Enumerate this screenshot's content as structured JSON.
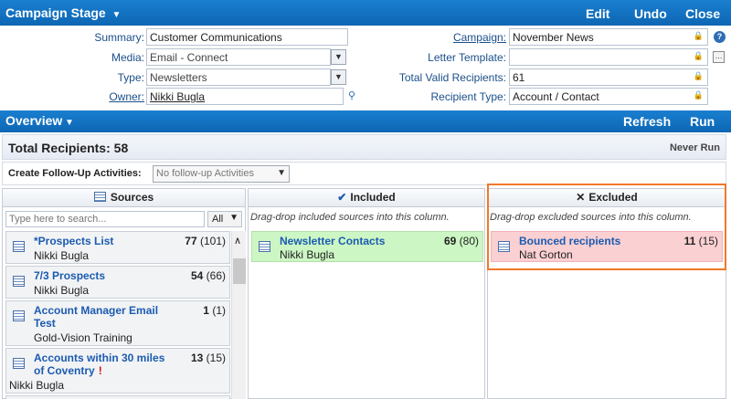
{
  "header": {
    "title": "Campaign Stage",
    "edit": "Edit",
    "undo": "Undo",
    "close": "Close"
  },
  "form": {
    "summary_label": "Summary:",
    "summary_value": "Customer Communications",
    "media_label": "Media:",
    "media_value": "Email - Connect",
    "type_label": "Type:",
    "type_value": "Newsletters",
    "owner_label": "Owner:",
    "owner_value": "Nikki Bugla",
    "campaign_label": "Campaign:",
    "campaign_value": "November News",
    "letter_label": "Letter Template:",
    "letter_value": "",
    "recipients_label": "Total Valid Recipients:",
    "recipients_value": "61",
    "rtype_label": "Recipient Type:",
    "rtype_value": "Account / Contact"
  },
  "overview": {
    "title": "Overview",
    "refresh": "Refresh",
    "run": "Run"
  },
  "totals": {
    "label": "Total Recipients:",
    "value": "58",
    "status": "Never Run"
  },
  "followup": {
    "label": "Create Follow-Up Activities:",
    "value": "No follow-up Activities"
  },
  "sources": {
    "title": "Sources",
    "search_placeholder": "Type here to search...",
    "filter": "All",
    "items": [
      {
        "name": "*Prospects List",
        "count": "77",
        "total": "(101)",
        "owner": "Nikki Bugla"
      },
      {
        "name": "7/3 Prospects",
        "count": "54",
        "total": "(66)",
        "owner": "Nikki Bugla"
      },
      {
        "name": "Account Manager Email Test",
        "count": "1",
        "total": "(1)",
        "owner": "Gold-Vision Training"
      },
      {
        "name": "Accounts within 30 miles of Coventry",
        "count": "13",
        "total": "(15)",
        "owner": "Nikki Bugla"
      }
    ]
  },
  "included": {
    "title": "Included",
    "hint": "Drag-drop included sources into this column.",
    "items": [
      {
        "name": "Newsletter Contacts",
        "count": "69",
        "total": "(80)",
        "owner": "Nikki Bugla"
      }
    ]
  },
  "excluded": {
    "title": "Excluded",
    "hint": "Drag-drop excluded sources into this column.",
    "items": [
      {
        "name": "Bounced recipients",
        "count": "11",
        "total": "(15)",
        "owner": "Nat Gorton"
      }
    ]
  }
}
